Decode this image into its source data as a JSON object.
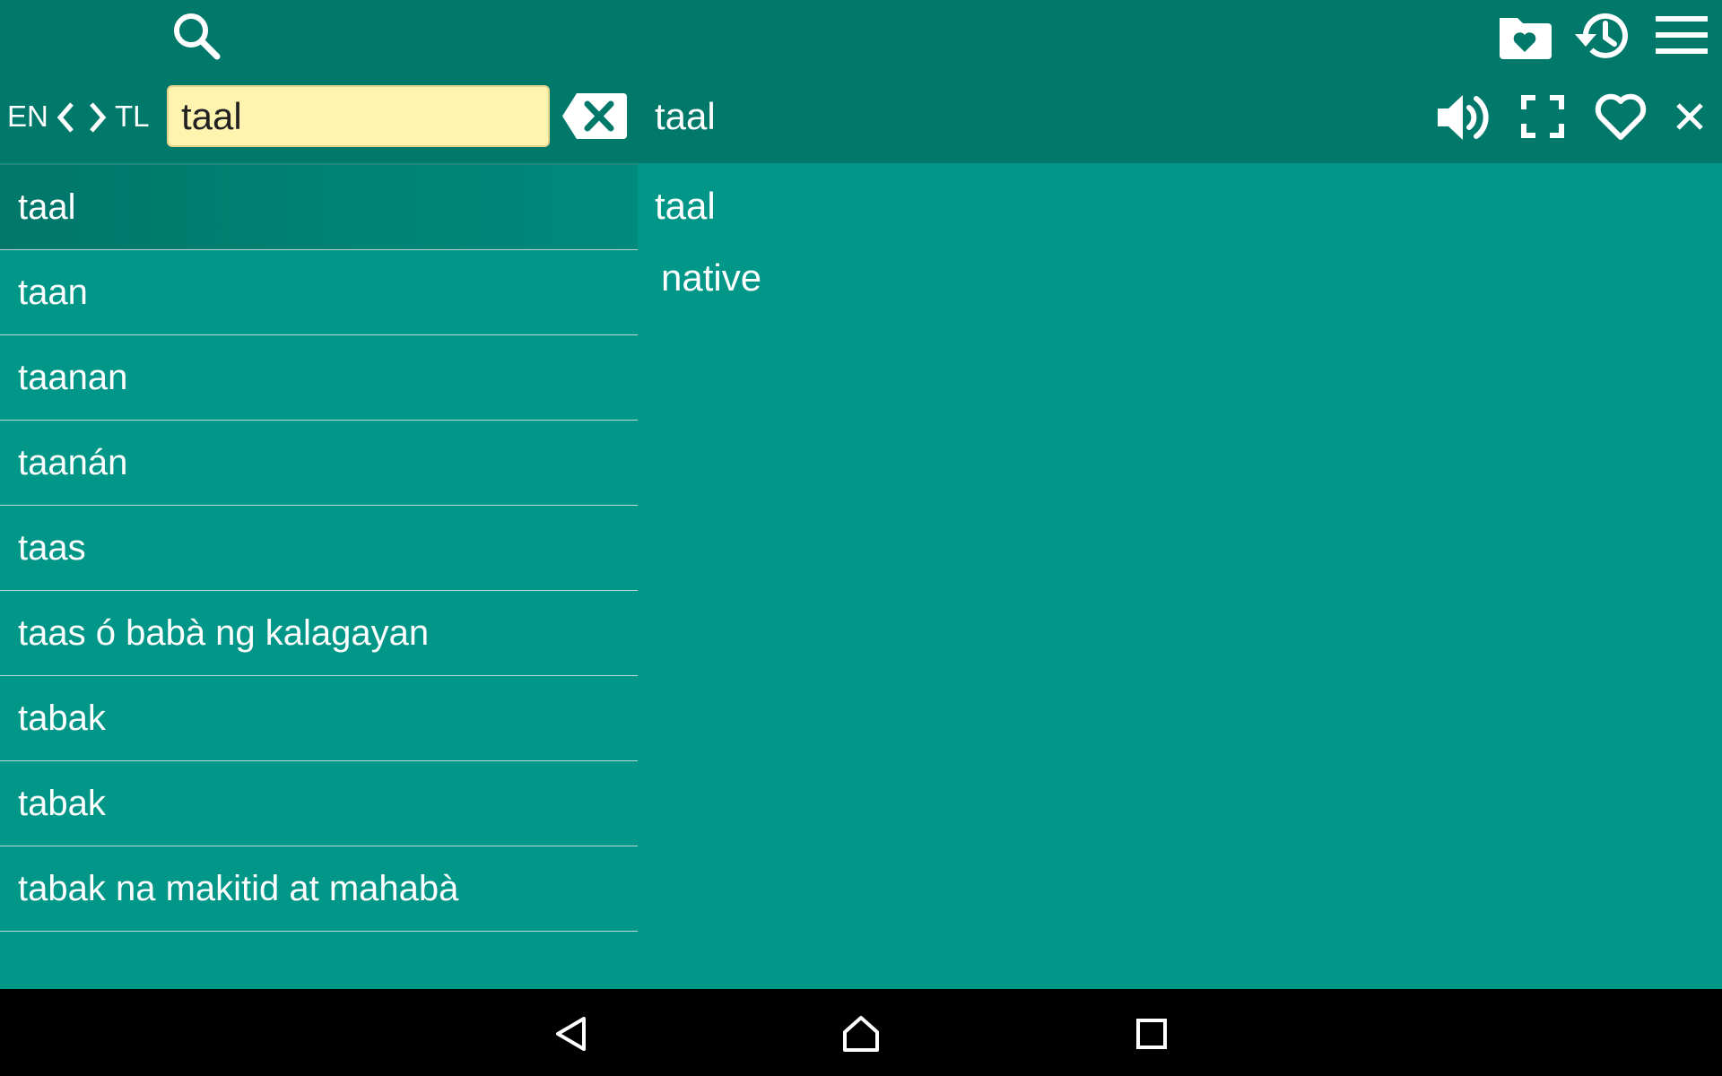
{
  "colors": {
    "toolbar": "#00796b",
    "background": "#009688",
    "selected_row": "#00776a",
    "search_field": "#fff3b0",
    "nav_bar": "#000000"
  },
  "toolbar": {
    "icons": [
      "search-icon",
      "favorites-folder-icon",
      "history-icon",
      "menu-icon"
    ]
  },
  "language": {
    "source": "EN",
    "target": "TL",
    "swap_icons": [
      "chevron-left-icon",
      "chevron-right-icon"
    ]
  },
  "search": {
    "value": "taal",
    "clear_icon": "backspace-clear-icon"
  },
  "entry_header": {
    "word": "taal",
    "actions": [
      "speaker-icon",
      "fullscreen-icon",
      "heart-icon",
      "close-icon"
    ]
  },
  "word_list": [
    "taal",
    "taan",
    "taanan",
    "taanán",
    "taas",
    "taas ó babà ng kalagayan",
    "tabak",
    "tabak",
    "tabak na makitid at mahabà"
  ],
  "selected_index": 0,
  "definition": {
    "word": "taal",
    "translation": "native"
  },
  "nav_bar": {
    "icons": [
      "back-icon",
      "home-icon",
      "recents-icon"
    ]
  }
}
